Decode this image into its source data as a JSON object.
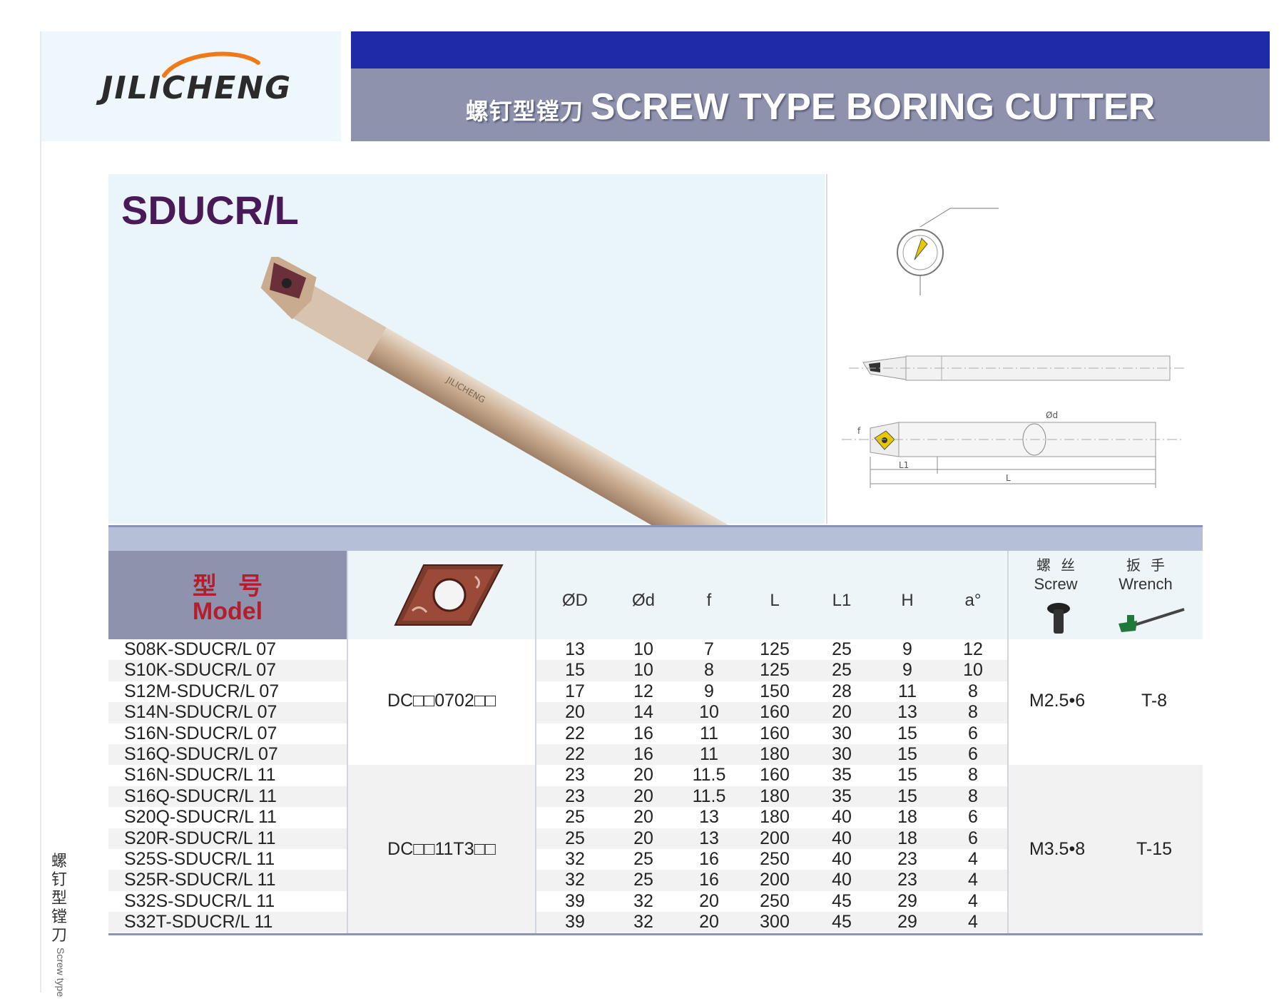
{
  "brand": {
    "logo_text": "JILICHENG",
    "tool_logo_text": "JILICHENG"
  },
  "header": {
    "title_cn": "螺钉型镗刀",
    "title_en": "SCREW TYPE BORING CUTTER"
  },
  "product": {
    "model_series": "SDUCR/L"
  },
  "table": {
    "model_header_cn": "型号",
    "model_header_en": "Model",
    "dim_headers": [
      "ØD",
      "Ød",
      "f",
      "L",
      "L1",
      "H",
      "a°"
    ],
    "screw_header_cn": "螺丝",
    "screw_header_en": "Screw",
    "wrench_header_cn": "扳手",
    "wrench_header_en": "Wrench",
    "groups": [
      {
        "insert": "DC□□0702□□",
        "screw": "M2.5•6",
        "wrench": "T-8"
      },
      {
        "insert": "DC□□11T3□□",
        "screw": "M3.5•8",
        "wrench": "T-15"
      }
    ],
    "rows": [
      {
        "model": "S08K-SDUCR/L 07",
        "D": "13",
        "d": "10",
        "f": "7",
        "L": "125",
        "L1": "25",
        "H": "9",
        "a": "12"
      },
      {
        "model": "S10K-SDUCR/L 07",
        "D": "15",
        "d": "10",
        "f": "8",
        "L": "125",
        "L1": "25",
        "H": "9",
        "a": "10"
      },
      {
        "model": "S12M-SDUCR/L 07",
        "D": "17",
        "d": "12",
        "f": "9",
        "L": "150",
        "L1": "28",
        "H": "11",
        "a": "8"
      },
      {
        "model": "S14N-SDUCR/L 07",
        "D": "20",
        "d": "14",
        "f": "10",
        "L": "160",
        "L1": "20",
        "H": "13",
        "a": "8"
      },
      {
        "model": "S16N-SDUCR/L 07",
        "D": "22",
        "d": "16",
        "f": "11",
        "L": "160",
        "L1": "30",
        "H": "15",
        "a": "6"
      },
      {
        "model": "S16Q-SDUCR/L 07",
        "D": "22",
        "d": "16",
        "f": "11",
        "L": "180",
        "L1": "30",
        "H": "15",
        "a": "6"
      },
      {
        "model": "S16N-SDUCR/L 11",
        "D": "23",
        "d": "20",
        "f": "11.5",
        "L": "160",
        "L1": "35",
        "H": "15",
        "a": "8"
      },
      {
        "model": "S16Q-SDUCR/L 11",
        "D": "23",
        "d": "20",
        "f": "11.5",
        "L": "180",
        "L1": "35",
        "H": "15",
        "a": "8"
      },
      {
        "model": "S20Q-SDUCR/L 11",
        "D": "25",
        "d": "20",
        "f": "13",
        "L": "180",
        "L1": "40",
        "H": "18",
        "a": "6"
      },
      {
        "model": "S20R-SDUCR/L 11",
        "D": "25",
        "d": "20",
        "f": "13",
        "L": "200",
        "L1": "40",
        "H": "18",
        "a": "6"
      },
      {
        "model": "S25S-SDUCR/L 11",
        "D": "32",
        "d": "25",
        "f": "16",
        "L": "250",
        "L1": "40",
        "H": "23",
        "a": "4"
      },
      {
        "model": "S25R-SDUCR/L 11",
        "D": "32",
        "d": "25",
        "f": "16",
        "L": "200",
        "L1": "40",
        "H": "23",
        "a": "4"
      },
      {
        "model": "S32S-SDUCR/L 11",
        "D": "39",
        "d": "32",
        "f": "20",
        "L": "250",
        "L1": "45",
        "H": "29",
        "a": "4"
      },
      {
        "model": "S32T-SDUCR/L 11",
        "D": "39",
        "d": "32",
        "f": "20",
        "L": "300",
        "L1": "45",
        "H": "29",
        "a": "4"
      }
    ]
  },
  "drawing": {
    "label_f": "f",
    "label_L1": "L1",
    "label_L": "L",
    "label_d": "Ød"
  },
  "side": {
    "text_cn": "螺钉型镗刀",
    "text_en": "Screw type"
  }
}
